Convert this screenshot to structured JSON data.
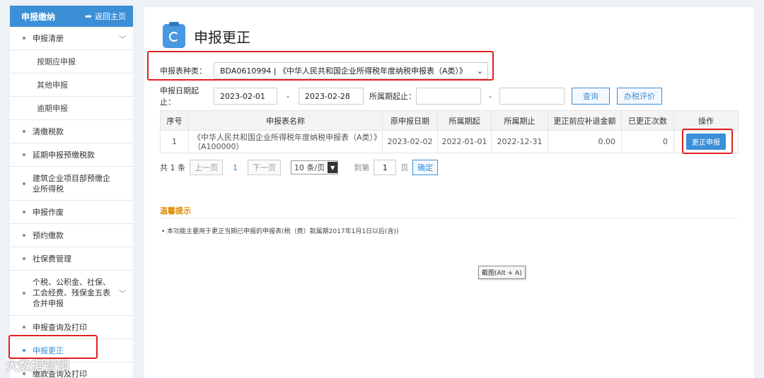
{
  "sidebar": {
    "title": "申报缴纳",
    "back_label": "返回主页",
    "items": [
      {
        "label": "申报清册",
        "chevron": true
      },
      {
        "label": "按期应申报",
        "sub": true
      },
      {
        "label": "其他申报",
        "sub": true
      },
      {
        "label": "逾期申报",
        "sub": true
      },
      {
        "label": "清缴税款"
      },
      {
        "label": "延期申报预缴税款"
      },
      {
        "label": "建筑企业项目部预缴企业所得税"
      },
      {
        "label": "申报作废"
      },
      {
        "label": "预约缴款"
      },
      {
        "label": "社保费管理"
      },
      {
        "label": "个税、公积金、社保、工会经费、残保金五表合并申报",
        "chevron": true
      },
      {
        "label": "申报查询及打印"
      },
      {
        "label": "申报更正",
        "active": true
      },
      {
        "label": "缴款查询及打印"
      }
    ]
  },
  "page": {
    "title": "申报更正"
  },
  "filters": {
    "type_label": "申报表种类：",
    "type_value": "BDA0610994 | 《中华人民共和国企业所得税年度纳税申报表（A类）》",
    "date_label": "申报日期起止：",
    "date_from": "2023-02-01",
    "date_sep": "-",
    "date_to": "2023-02-28",
    "period_label": "所属期起止：",
    "period_from": "",
    "period_sep": "-",
    "period_to": "",
    "query_button": "查询",
    "eval_button": "办税评价"
  },
  "table": {
    "headers": [
      "序号",
      "申报表名称",
      "原申报日期",
      "所属期起",
      "所属期止",
      "更正前应补退金额",
      "已更正次数",
      "操作"
    ],
    "rows": [
      {
        "index": "1",
        "name": "《中华人民共和国企业所得税年度纳税申报表（A类）》（A100000）",
        "orig_date": "2023-02-02",
        "period_start": "2022-01-01",
        "period_end": "2022-12-31",
        "amount": "0.00",
        "count": "0",
        "action": "更正申报"
      }
    ]
  },
  "pager": {
    "total": "共 1 条",
    "prev": "上一页",
    "current": "1",
    "next": "下一页",
    "page_size": "10 条/页",
    "goto_label": "到第",
    "goto_value": "1",
    "page_unit": "页",
    "confirm": "确定"
  },
  "tips": {
    "title": "温馨提示",
    "text": "• 本功能主要用于更正当期已申报的申报表(税（费）款属期2017年1月1日以后(含))"
  },
  "tooltip": "截图(Alt + A)",
  "watermark": "大数据营销",
  "colors": {
    "accent": "#3b8fd7",
    "highlight_box": "#e02020",
    "tips_title": "#e08a00"
  }
}
